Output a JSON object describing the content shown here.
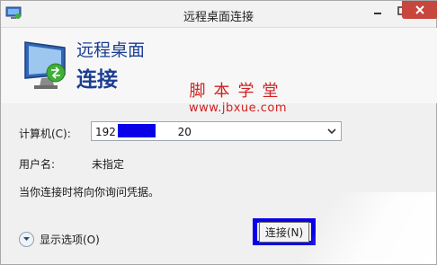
{
  "window": {
    "title": "远程桌面连接",
    "controls": {
      "minimize": "minimize",
      "maximize": "maximize",
      "close": "close"
    }
  },
  "header": {
    "line1": "远程桌面",
    "line2": "连接",
    "icon": "remote-desktop-monitor-icon"
  },
  "watermark": {
    "text_cn": "脚本学堂",
    "url": "www.jbxue.com"
  },
  "form": {
    "computer_label": "计算机(C):",
    "computer_value": "192                  20",
    "computer_value_redacted": true,
    "username_label": "用户名:",
    "username_value": "未指定",
    "hint": "当你连接时将向你询问凭据。"
  },
  "footer": {
    "options_label": "显示选项(O)",
    "connect_label": "连接(N)"
  },
  "colors": {
    "header_text": "#1b3e93",
    "close_button": "#c7463d",
    "redaction": "#0a00e8",
    "watermark": "#d21f1f"
  }
}
